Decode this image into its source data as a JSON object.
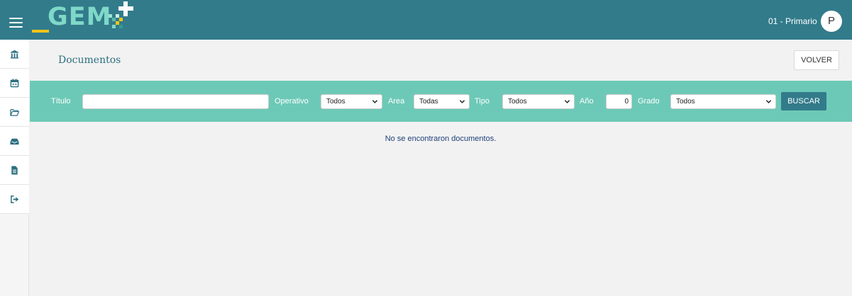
{
  "header": {
    "logo_text": "GEM",
    "user_label": "01 - Primario",
    "avatar_initial": "P"
  },
  "sidebar": {
    "items": [
      {
        "icon": "school-icon"
      },
      {
        "icon": "calendar-icon"
      },
      {
        "icon": "folder-open-icon"
      },
      {
        "icon": "inbox-icon"
      },
      {
        "icon": "document-icon"
      },
      {
        "icon": "sign-out-icon"
      }
    ]
  },
  "main": {
    "title": "Documentos",
    "back_button": "VOLVER"
  },
  "filters": {
    "titulo_label": "Título",
    "titulo_value": "",
    "operativo_label": "Operativo",
    "operativo_value": "Todos",
    "area_label": "Area",
    "area_value": "Todas",
    "tipo_label": "Tipo",
    "tipo_value": "Todos",
    "anio_label": "Año",
    "anio_value": "0",
    "grado_label": "Grado",
    "grado_value": "Todos",
    "search_button": "BUSCAR"
  },
  "results": {
    "empty_message": "No se encontraron documentos."
  },
  "colors": {
    "header_bg": "#327b8b",
    "filter_bg": "#6dc9b7",
    "logo_accent": "#f0c419",
    "logo_text": "#7fd8c8"
  }
}
